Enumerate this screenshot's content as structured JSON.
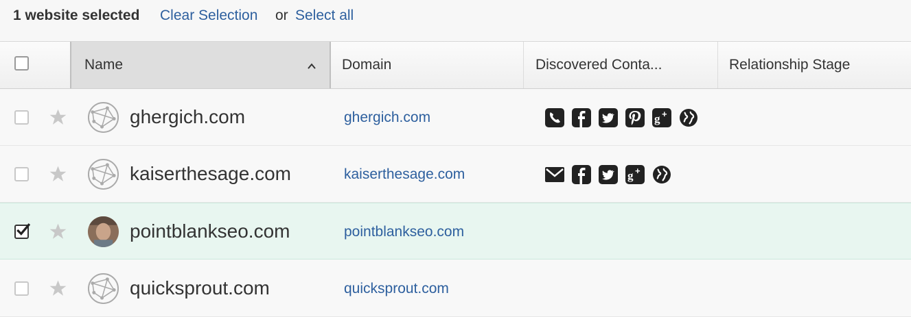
{
  "selection": {
    "count_text": "1 website selected",
    "clear_label": "Clear Selection",
    "or_text": "or",
    "select_all_label": "Select all"
  },
  "columns": {
    "name": "Name",
    "domain": "Domain",
    "contacts": "Discovered Conta...",
    "stage": "Relationship Stage"
  },
  "rows": [
    {
      "name": "ghergich.com",
      "domain": "ghergich.com",
      "selected": false,
      "contacts": [
        "phone-icon",
        "facebook-icon",
        "twitter-icon",
        "pinterest-icon",
        "google-plus-icon",
        "website-icon"
      ]
    },
    {
      "name": "kaiserthesage.com",
      "domain": "kaiserthesage.com",
      "selected": false,
      "contacts": [
        "email-icon",
        "facebook-icon",
        "twitter-icon",
        "google-plus-icon",
        "website-icon"
      ]
    },
    {
      "name": "pointblankseo.com",
      "domain": "pointblankseo.com",
      "selected": true,
      "contacts": []
    },
    {
      "name": "quicksprout.com",
      "domain": "quicksprout.com",
      "selected": false,
      "contacts": []
    }
  ],
  "colors": {
    "link": "#2d5f9e",
    "selected_row": "#e8f6f0"
  }
}
